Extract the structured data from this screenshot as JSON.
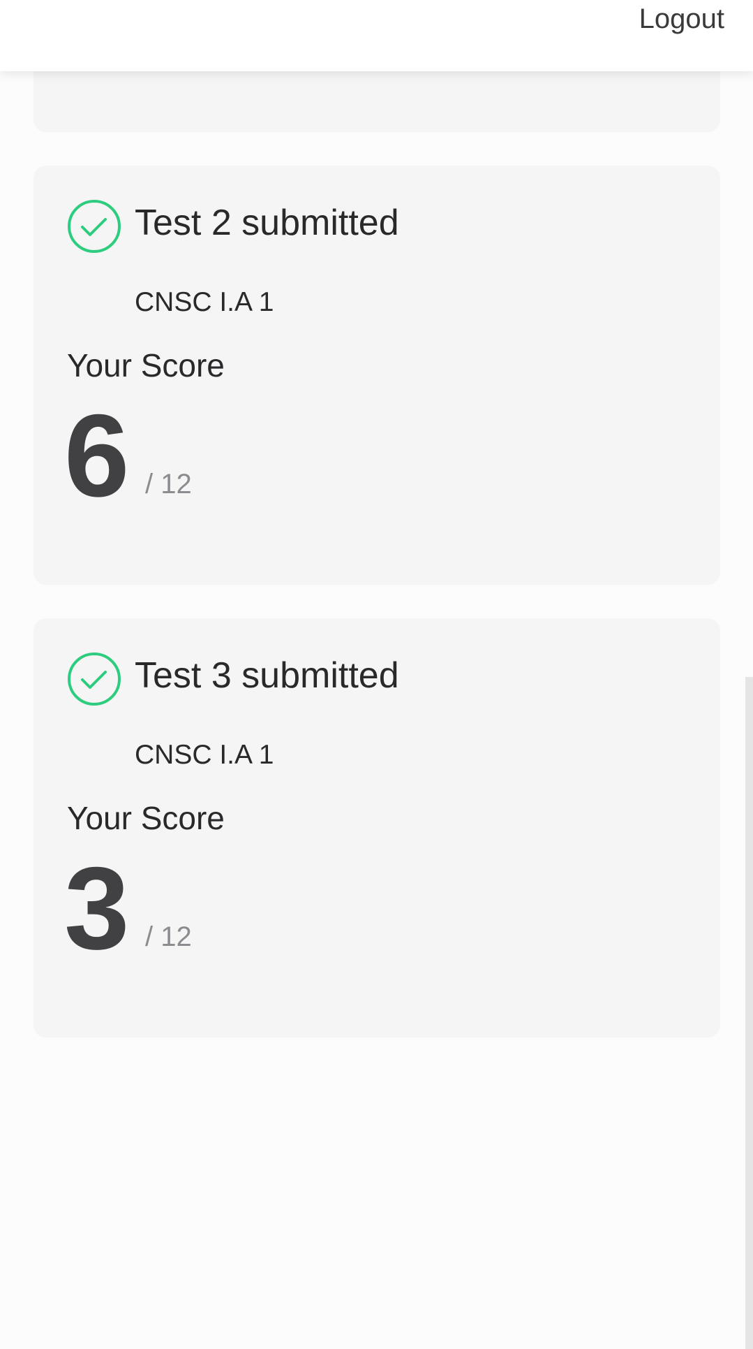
{
  "header": {
    "logout_label": "Logout"
  },
  "cards": [
    {
      "status_text": "Test 2 submitted",
      "test_name": "CNSC I.A 1",
      "score_label": "Your Score",
      "score": "6",
      "score_total": "/ 12",
      "status_icon": "check-circle-icon"
    },
    {
      "status_text": "Test 3 submitted",
      "test_name": "CNSC I.A 1",
      "score_label": "Your Score",
      "score": "3",
      "score_total": "/ 12",
      "status_icon": "check-circle-icon"
    }
  ],
  "colors": {
    "success": "#2ecc7f",
    "card_background": "#f5f5f5",
    "score_value": "#414043",
    "score_total": "#8c8b8f"
  }
}
